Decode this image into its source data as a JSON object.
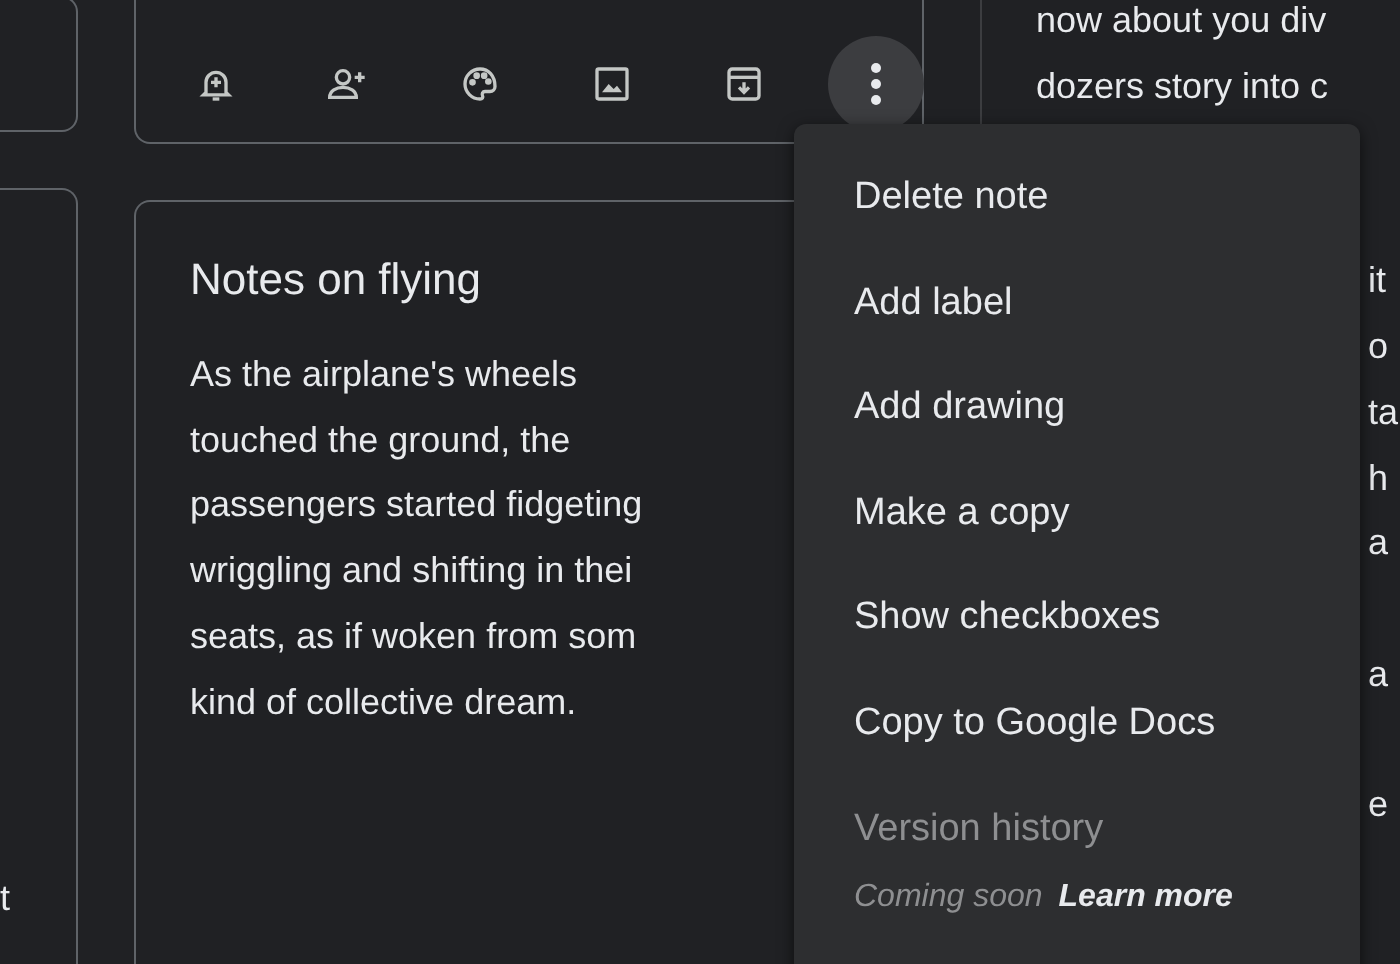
{
  "left_column": {
    "text_fragment": "t"
  },
  "top_note": {
    "toolbar": [
      {
        "kind": "reminder",
        "active": false
      },
      {
        "kind": "collaborator",
        "active": false
      },
      {
        "kind": "palette",
        "active": false
      },
      {
        "kind": "image",
        "active": false
      },
      {
        "kind": "archive",
        "active": false
      },
      {
        "kind": "more",
        "active": true
      }
    ]
  },
  "note": {
    "title": "Notes on flying",
    "lines": [
      "As the airplane's wheels",
      "touched the ground, the",
      "passengers started fidgeting",
      "wriggling and shifting in thei",
      "seats, as if woken from som",
      "kind of collective dream."
    ]
  },
  "right_note": {
    "top_lines": [
      "now about you div",
      "dozers story into c"
    ],
    "fragments": [
      [
        "it",
        "o",
        "ta",
        "h",
        "a"
      ],
      [
        "a"
      ],
      [
        "e"
      ]
    ]
  },
  "menu": {
    "items": [
      {
        "label": "Delete note",
        "disabled": false
      },
      {
        "label": "Add label",
        "disabled": false
      },
      {
        "label": "Add drawing",
        "disabled": false
      },
      {
        "label": "Make a copy",
        "disabled": false
      },
      {
        "label": "Show checkboxes",
        "disabled": false
      },
      {
        "label": "Copy to Google Docs",
        "disabled": false
      },
      {
        "label": "Version history",
        "disabled": true
      }
    ],
    "footer": {
      "note": "Coming soon",
      "link": "Learn more"
    }
  }
}
